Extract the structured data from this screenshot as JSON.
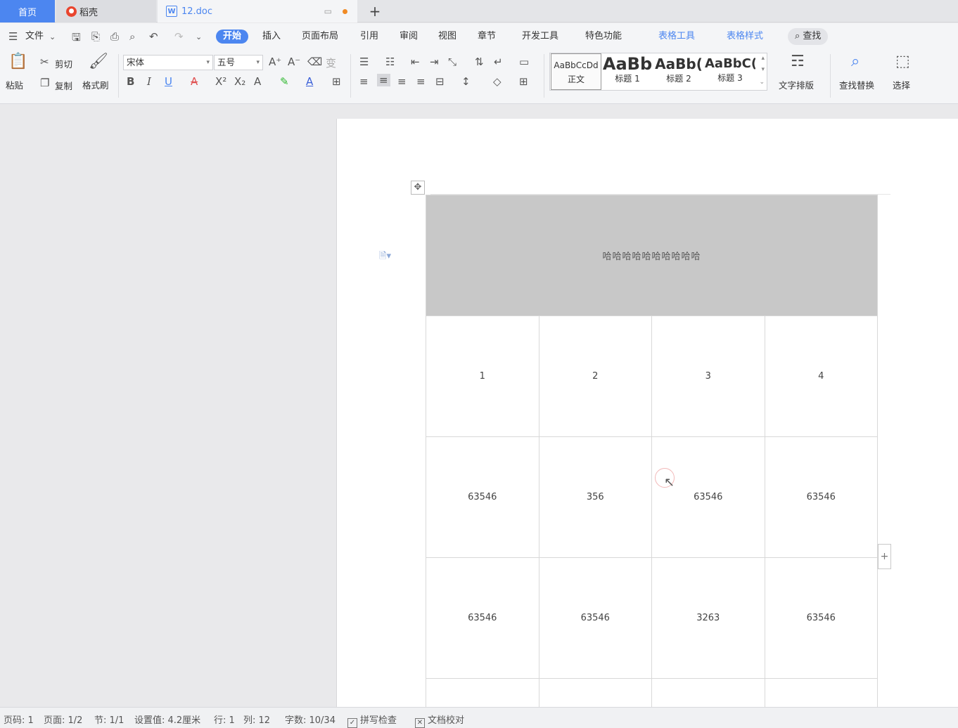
{
  "tabs": {
    "home": "首页",
    "daoke": "稻壳",
    "doc": "12.doc",
    "add": "+"
  },
  "menu": {
    "file": "文件",
    "items": [
      "开始",
      "插入",
      "页面布局",
      "引用",
      "审阅",
      "视图",
      "章节",
      "开发工具",
      "特色功能"
    ],
    "table_tools": "表格工具",
    "table_style": "表格样式",
    "search": "查找"
  },
  "ribbon": {
    "paste": "粘贴",
    "cut": "剪切",
    "copy": "复制",
    "format_painter": "格式刷",
    "font_name": "宋体",
    "font_size": "五号",
    "styles": [
      {
        "preview": "AaBbCcDd",
        "name": "正文"
      },
      {
        "preview": "AaBb",
        "name": "标题 1"
      },
      {
        "preview": "AaBb(",
        "name": "标题 2"
      },
      {
        "preview": "AaBbC(",
        "name": "标题 3"
      }
    ],
    "text_layout": "文字排版",
    "find_replace": "查找替换",
    "select": "选择"
  },
  "table": {
    "header": "哈哈哈哈哈哈哈哈哈哈",
    "rows": [
      [
        "1",
        "2",
        "3",
        "4"
      ],
      [
        "63546",
        "356",
        "63546",
        "63546"
      ],
      [
        "63546",
        "63546",
        "3263",
        "63546"
      ],
      [
        "",
        "",
        "",
        ""
      ]
    ],
    "add_row": "+"
  },
  "status": {
    "page_num": "页码: 1",
    "page": "页面: 1/2",
    "section": "节: 1/1",
    "setting": "设置值: 4.2厘米",
    "line": "行: 1",
    "col": "列: 12",
    "words": "字数: 10/34",
    "spell": "拼写检查",
    "proof": "文档校对"
  },
  "colors": {
    "accent": "#4c86f0",
    "header_fill": "#c8c8c8"
  }
}
